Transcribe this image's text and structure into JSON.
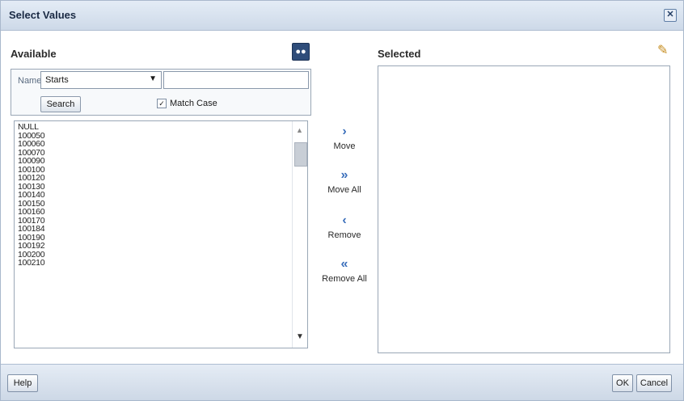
{
  "dialog": {
    "title": "Select Values",
    "close_glyph": "✕"
  },
  "available": {
    "label": "Available",
    "filter_label": "Name",
    "operator_value": "Starts",
    "search_value": "",
    "search_button": "Search",
    "match_case_label": "Match Case",
    "match_case_checked": true,
    "items": [
      "NULL",
      "100050",
      "100060",
      "100070",
      "100090",
      "100100",
      "100120",
      "100130",
      "100140",
      "100150",
      "100160",
      "100170",
      "100184",
      "100190",
      "100192",
      "100200",
      "100210"
    ]
  },
  "shuttle": {
    "move": "Move",
    "move_all": "Move All",
    "remove": "Remove",
    "remove_all": "Remove All"
  },
  "selected": {
    "label": "Selected",
    "items": []
  },
  "footer": {
    "help": "Help",
    "ok": "OK",
    "cancel": "Cancel"
  },
  "icons": {
    "binoculars": "binoculars-icon",
    "edit": "pencil-icon",
    "move": "chevron-right-icon",
    "move_all": "double-chevron-right-icon",
    "remove": "chevron-left-icon",
    "remove_all": "double-chevron-left-icon"
  },
  "colors": {
    "accent": "#3b6fbb",
    "titlebar": "#cdd9e8"
  }
}
